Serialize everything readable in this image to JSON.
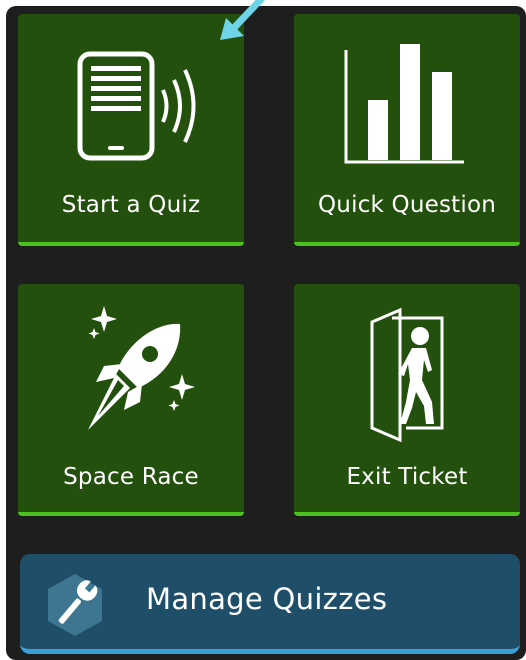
{
  "tiles": {
    "start_quiz": {
      "label": "Start a Quiz",
      "icon": "tablet-broadcast-icon"
    },
    "quick_question": {
      "label": "Quick Question",
      "icon": "bar-chart-icon"
    },
    "space_race": {
      "label": "Space Race",
      "icon": "rocket-icon"
    },
    "exit_ticket": {
      "label": "Exit Ticket",
      "icon": "exit-door-icon"
    }
  },
  "manage": {
    "label": "Manage Quizzes",
    "icon": "wrench-icon"
  },
  "colors": {
    "tile_bg": "#23510d",
    "tile_accent": "#4cc21f",
    "manage_bg": "#1f4e68",
    "manage_accent": "#3aa0d6",
    "page_bg": "#1e1e1e",
    "pointer": "#6fd4e8"
  }
}
